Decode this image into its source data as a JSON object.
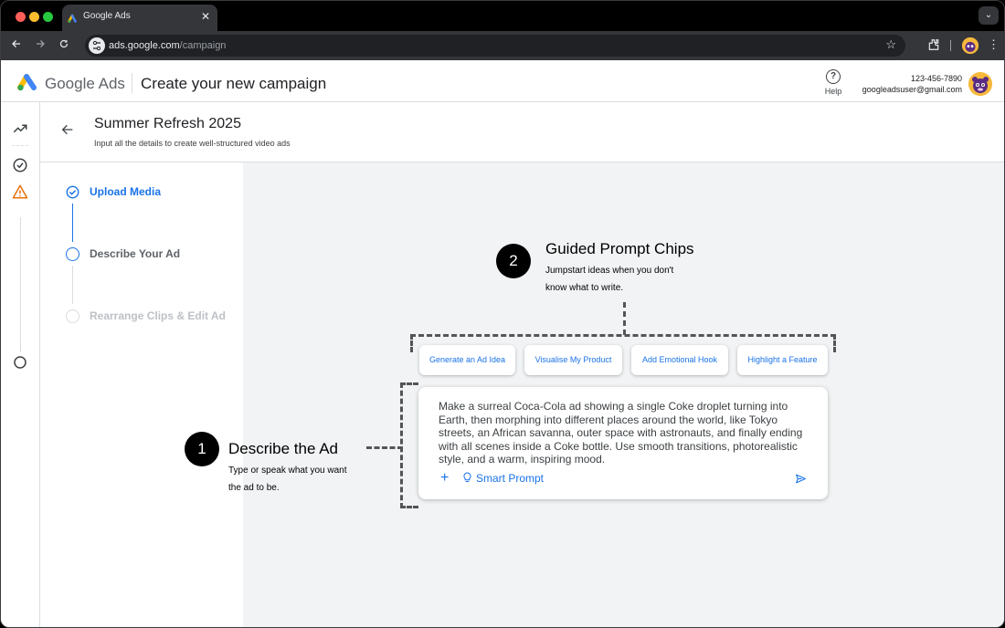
{
  "browser": {
    "tab_title": "Google Ads",
    "tab_close": "✕",
    "tab_menu_icon": "⌄",
    "url_domain": "ads.google.com",
    "url_path": "/campaign"
  },
  "header": {
    "brand": "Google Ads",
    "page_title": "Create your new campaign",
    "help_label": "Help",
    "help_icon_glyph": "?",
    "phone": "123-456-7890",
    "email": "googleadsuser@gmail.com"
  },
  "campaign": {
    "title": "Summer Refresh 2025",
    "subtitle": "Input all the details to create well-structured video ads"
  },
  "steps": [
    {
      "label": "Upload Media",
      "state": "completed"
    },
    {
      "label": "Describe Your Ad",
      "state": "current"
    },
    {
      "label": "Rearrange Clips & Edit Ad",
      "state": "upcoming"
    }
  ],
  "annotations": {
    "guided": {
      "number": "2",
      "title": "Guided Prompt Chips",
      "desc_line1": "Jumpstart ideas when you don't",
      "desc_line2": "know what to write."
    },
    "describe": {
      "number": "1",
      "title": "Describe the Ad",
      "desc_line1": "Type or speak what you want",
      "desc_line2": "the ad to be."
    }
  },
  "chips": [
    "Generate an Ad Idea",
    "Visualise My Product",
    "Add Emotional Hook",
    "Highlight a Feature"
  ],
  "prompt": {
    "text": "Make a surreal Coca-Cola ad showing a single Coke droplet turning into Earth, then morphing into different places around the world, like Tokyo streets, an African savanna, outer space with astronauts, and finally ending with all scenes inside a Coke bottle. Use smooth transitions, photorealistic style, and a warm, inspiring mood.",
    "smart_prompt_label": "Smart Prompt",
    "plus_glyph": "+"
  },
  "colors": {
    "accent": "#1a73e8",
    "warning": "#e8710a",
    "canvas": "#f1f3f4"
  }
}
